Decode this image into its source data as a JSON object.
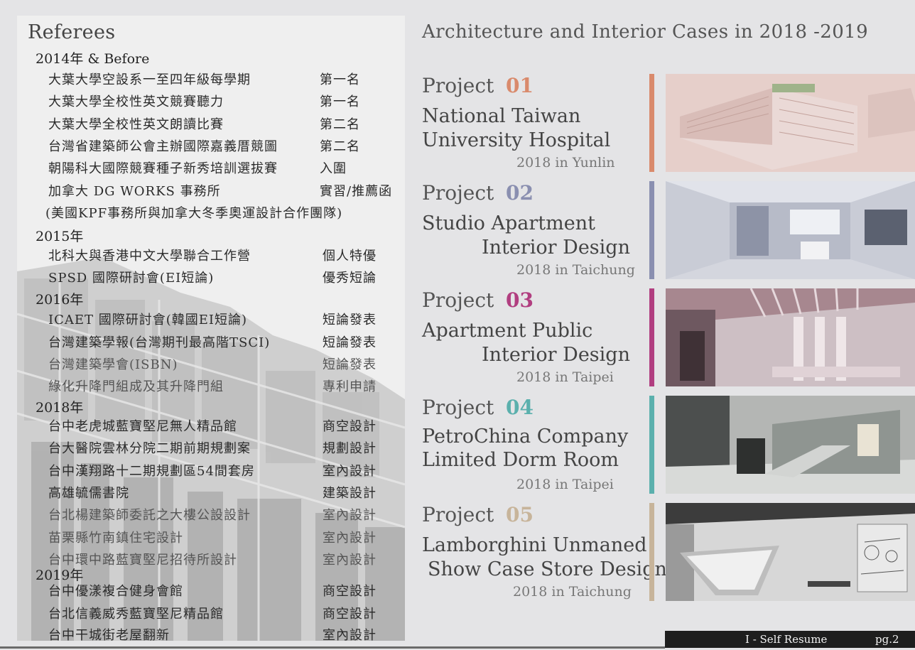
{
  "left": {
    "title": "Referees",
    "groups": [
      {
        "year": "2014年  & Before",
        "entries": [
          {
            "name": "大葉大學空設系一至四年級每學期",
            "award": "第一名"
          },
          {
            "name": "大葉大學全校性英文競賽聽力",
            "award": "第一名"
          },
          {
            "name": "大葉大學全校性英文朗讀比賽",
            "award": "第二名"
          },
          {
            "name": "台灣省建築師公會主辦國際嘉義厝競圖",
            "award": "第二名"
          },
          {
            "name": "朝陽科大國際競賽種子新秀培訓選拔賽",
            "award": "入圍"
          },
          {
            "name": "加拿大  DG WORKS 事務所",
            "award": "實習/推薦函"
          }
        ],
        "note": "(美國KPF事務所與加拿大冬季奧運設計合作團隊)"
      },
      {
        "year": "2015年",
        "entries": [
          {
            "name": "北科大與香港中文大學聯合工作營",
            "award": "個人特優"
          },
          {
            "name": "SPSD 國際研討會(EI短論)",
            "award": "優秀短論"
          }
        ]
      },
      {
        "year": "2016年",
        "entries": [
          {
            "name": "ICAET 國際研討會(韓國EI短論)",
            "award": "短論發表"
          },
          {
            "name": "台灣建築學報(台灣期刊最高階TSCI)",
            "award": "短論發表"
          },
          {
            "name": "台灣建築學會(ISBN)",
            "award": "短論發表"
          },
          {
            "name": "綠化升降門組成及其升降門組",
            "award": "專利申請"
          }
        ]
      },
      {
        "year": "2018年",
        "entries": [
          {
            "name": "台中老虎城藍寶堅尼無人精品館",
            "award": "商空設計"
          },
          {
            "name": "台大醫院雲林分院二期前期規劃案",
            "award": "規劃設計"
          },
          {
            "name": "台中漢翔路十二期規劃區54間套房",
            "award": "室內設計"
          },
          {
            "name": "高雄毓儒書院",
            "award": "建築設計"
          },
          {
            "name": "台北楊建築師委託之大樓公設設計",
            "award": "室內設計"
          },
          {
            "name": "苗栗縣竹南鎮住宅設計",
            "award": "室內設計"
          },
          {
            "name": "台中環中路藍寶堅尼招待所設計",
            "award": "室內設計"
          }
        ]
      },
      {
        "year": "2019年",
        "entries": [
          {
            "name": "台中優漾複合健身會館",
            "award": "商空設計"
          },
          {
            "name": "台北信義威秀藍寶堅尼精品館",
            "award": "商空設計"
          },
          {
            "name": "台中干城街老屋翻新",
            "award": "室內設計"
          }
        ]
      }
    ]
  },
  "right": {
    "title": "Architecture and Interior Cases in 2018 -2019",
    "projects": [
      {
        "label": "Project",
        "num": "01",
        "line1": "National Taiwan",
        "line2": "University Hospital",
        "sub": "2018 in Yunlin",
        "color": "#d98a6c"
      },
      {
        "label": "Project",
        "num": "02",
        "line1": "Studio Apartment",
        "line2": "Interior Design",
        "sub": "2018 in Taichung",
        "color": "#8a8fb0"
      },
      {
        "label": "Project",
        "num": "03",
        "line1": "Apartment Public",
        "line2": "Interior Design",
        "sub": "2018 in Taipei",
        "color": "#b13e80"
      },
      {
        "label": "Project",
        "num": "04",
        "line1": "PetroChina Company",
        "line2": "Limited Dorm Room",
        "sub": "2018 in Taipei",
        "color": "#5bb0ad"
      },
      {
        "label": "Project",
        "num": "05",
        "line1": "Lamborghini Unmaned",
        "line2": "Show Case Store Design",
        "sub": "2018 in Taichung",
        "color": "#c7b49a"
      }
    ]
  },
  "footer": {
    "title": "I - Self  Resume",
    "page": "pg.2"
  }
}
